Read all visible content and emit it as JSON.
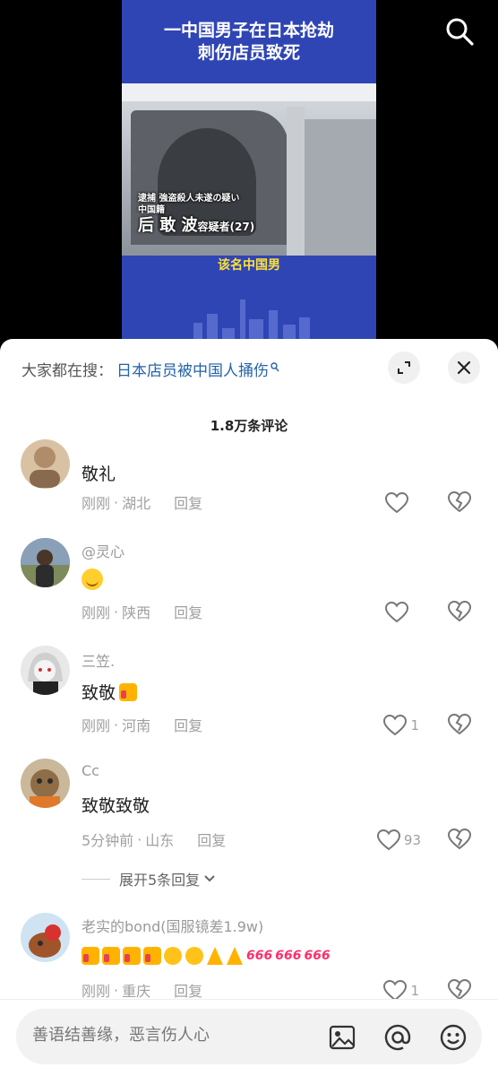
{
  "video": {
    "headline_line1": "一中国男子在日本抢劫",
    "headline_line2": "刺伤店员致死",
    "caption_line1": "逮捕 強盗殺人未遂の疑い",
    "caption_line2": "中国籍",
    "caption_name": "后 敢 波",
    "caption_suffix": "容疑者(27)",
    "subtitle": "该名中国男"
  },
  "hot_search": {
    "label": "大家都在搜：",
    "query": "日本店员被中国人捅伤"
  },
  "comments_count": "1.8万条评论",
  "comments": [
    {
      "user": "",
      "text": "敬礼",
      "time": "刚刚",
      "location": "湖北",
      "reply": "回复",
      "likes": ""
    },
    {
      "user": "@灵心",
      "text": "",
      "time": "刚刚",
      "location": "陕西",
      "reply": "回复",
      "likes": ""
    },
    {
      "user": "三笠.",
      "text": "致敬",
      "time": "刚刚",
      "location": "河南",
      "reply": "回复",
      "likes": "1"
    },
    {
      "user": "Cc",
      "text": "致敬致敬",
      "time": "5分钟前",
      "location": "山东",
      "reply": "回复",
      "likes": "93"
    },
    {
      "user": "老实的bond(国服镜差1.9w)",
      "text": "",
      "time": "刚刚",
      "location": "重庆",
      "reply": "回复",
      "likes": "1"
    }
  ],
  "expand_replies": "展开5条回复",
  "input_placeholder": "善语结善缘，恶言伤人心",
  "icons": {
    "search": "search-icon",
    "expand": "expand-icon",
    "close": "close-icon",
    "like": "heart-icon",
    "dislike": "broken-heart-icon",
    "image": "image-icon",
    "mention": "at-icon",
    "emoji": "emoji-icon"
  },
  "colors": {
    "video_bg": "#2f45b4",
    "hot_query": "#2463a7",
    "caption_yellow": "#ffe23a"
  }
}
